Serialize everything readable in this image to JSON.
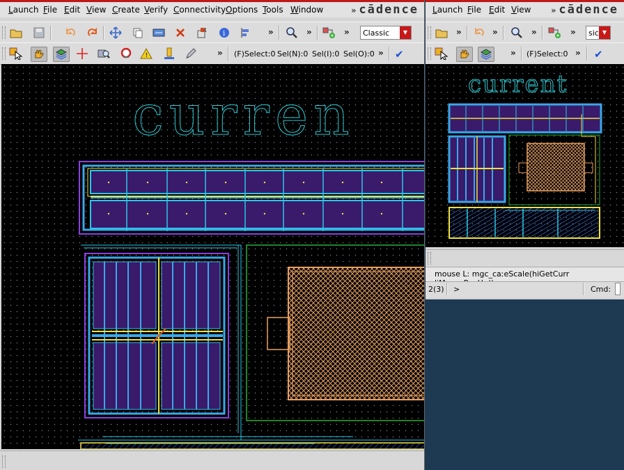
{
  "main_window": {
    "menu": [
      "Launch",
      "File",
      "Edit",
      "View",
      "Create",
      "Verify",
      "Connectivity",
      "Options",
      "Tools",
      "Window"
    ],
    "brand": "cādence",
    "brand_chevron": "»",
    "more": "»",
    "view_mode": "Classic",
    "status": {
      "f_select": "(F)Select:0",
      "sel_n": "Sel(N):0",
      "sel_i": "Sel(I):0",
      "sel_o": "Sel(O):0"
    },
    "cell_label": "curren"
  },
  "side_window": {
    "menu": [
      "Launch",
      "File",
      "Edit",
      "View"
    ],
    "brand": "cādence",
    "brand_chevron": "»",
    "more": "»",
    "view_mode": "sic",
    "status": {
      "f_select": "(F)Select:0"
    },
    "cell_label": "current",
    "mouse_line": "mouse L: mgc_caːeScale(hiGetCurr liMousePopUp()",
    "prompt_num": "2(3)",
    "prompt_char": ">",
    "cmd_label": "Cmd:"
  },
  "colors": {
    "accent_red": "#c01818",
    "canvas_bg": "#000000",
    "text_cyan": "#2ec8d0",
    "desktop": "#1d3a52"
  },
  "icons": {
    "toolbar1": [
      "open-folder-icon",
      "save-icon",
      "undo-icon",
      "redo-icon",
      "move-icon",
      "copy-icon",
      "stretch-icon",
      "delete-icon",
      "properties-icon",
      "info-icon",
      "align-icon",
      "zoom-icon",
      "create-instance-icon"
    ],
    "toolbar2": [
      "select-pointer-icon",
      "hand-pan-icon",
      "layer-stack-icon",
      "crosshair-icon",
      "magnify-probe-icon",
      "stop-icon",
      "warning-icon",
      "ruler-icon",
      "edit-pen-icon",
      "checkmark-icon"
    ]
  }
}
